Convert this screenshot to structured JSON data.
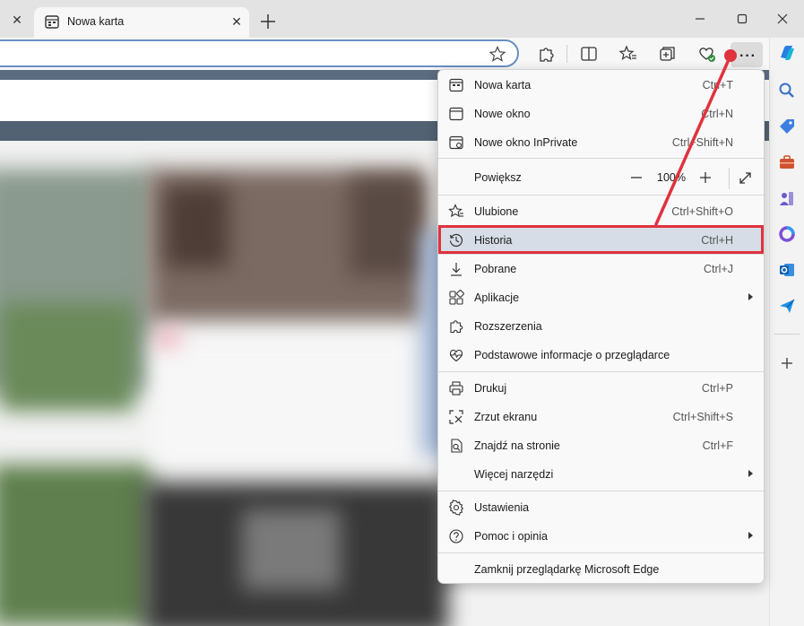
{
  "tabs": {
    "active_title": "Nowa karta"
  },
  "menu": {
    "items": [
      {
        "label": "Nowa karta",
        "shortcut": "Ctrl+T",
        "icon": "new-tab-icon"
      },
      {
        "label": "Nowe okno",
        "shortcut": "Ctrl+N",
        "icon": "new-window-icon"
      },
      {
        "label": "Nowe okno InPrivate",
        "shortcut": "Ctrl+Shift+N",
        "icon": "inprivate-icon"
      },
      {
        "label": "Powiększ",
        "zoom_value": "100%",
        "icon": "none"
      },
      {
        "label": "Ulubione",
        "shortcut": "Ctrl+Shift+O",
        "icon": "favorites-icon"
      },
      {
        "label": "Historia",
        "shortcut": "Ctrl+H",
        "icon": "history-icon"
      },
      {
        "label": "Pobrane",
        "shortcut": "Ctrl+J",
        "icon": "download-icon"
      },
      {
        "label": "Aplikacje",
        "shortcut": "",
        "icon": "apps-icon"
      },
      {
        "label": "Rozszerzenia",
        "shortcut": "",
        "icon": "extensions-icon"
      },
      {
        "label": "Podstawowe informacje o przeglądarce",
        "shortcut": "",
        "icon": "browser-essentials-icon"
      },
      {
        "label": "Drukuj",
        "shortcut": "Ctrl+P",
        "icon": "print-icon"
      },
      {
        "label": "Zrzut ekranu",
        "shortcut": "Ctrl+Shift+S",
        "icon": "screenshot-icon"
      },
      {
        "label": "Znajdź na stronie",
        "shortcut": "Ctrl+F",
        "icon": "find-icon"
      },
      {
        "label": "Więcej narzędzi",
        "shortcut": "",
        "icon": "none"
      },
      {
        "label": "Ustawienia",
        "shortcut": "",
        "icon": "settings-icon"
      },
      {
        "label": "Pomoc i opinia",
        "shortcut": "",
        "icon": "help-icon"
      },
      {
        "label": "Zamknij przeglądarkę Microsoft Edge",
        "shortcut": "",
        "icon": "none"
      }
    ]
  },
  "colors": {
    "annotation": "#e0323f",
    "highlight": "#d6dde6",
    "address_border": "#6a8fc2"
  }
}
